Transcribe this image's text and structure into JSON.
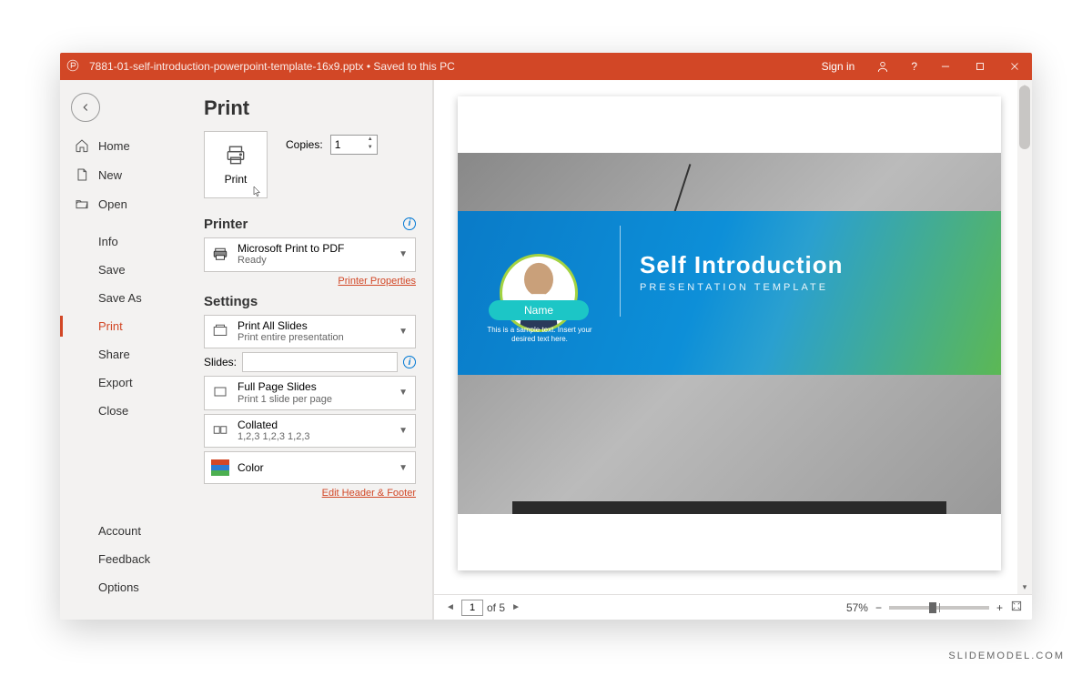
{
  "titlebar": {
    "filename": "7881-01-self-introduction-powerpoint-template-16x9.pptx • Saved to this PC",
    "signin": "Sign in"
  },
  "nav": {
    "home": "Home",
    "new": "New",
    "open": "Open",
    "info": "Info",
    "save": "Save",
    "saveas": "Save As",
    "print": "Print",
    "share": "Share",
    "export": "Export",
    "close": "Close",
    "account": "Account",
    "feedback": "Feedback",
    "options": "Options"
  },
  "print": {
    "heading": "Print",
    "print_btn": "Print",
    "copies_label": "Copies:",
    "copies_value": "1",
    "printer_heading": "Printer",
    "printer_name": "Microsoft Print to PDF",
    "printer_status": "Ready",
    "printer_props": "Printer Properties",
    "settings_heading": "Settings",
    "scope_title": "Print All Slides",
    "scope_sub": "Print entire presentation",
    "slides_label": "Slides:",
    "layout_title": "Full Page Slides",
    "layout_sub": "Print 1 slide per page",
    "collate_title": "Collated",
    "collate_sub": "1,2,3    1,2,3    1,2,3",
    "color_title": "Color",
    "edit_hf": "Edit Header & Footer"
  },
  "slide": {
    "title": "Self Introduction",
    "subtitle": "PRESENTATION TEMPLATE",
    "name_label": "Name",
    "sample": "This is a sample text. Insert your desired text here."
  },
  "status": {
    "page_current": "1",
    "page_total": "of 5",
    "zoom": "57%"
  },
  "watermark": "SLIDEMODEL.COM"
}
